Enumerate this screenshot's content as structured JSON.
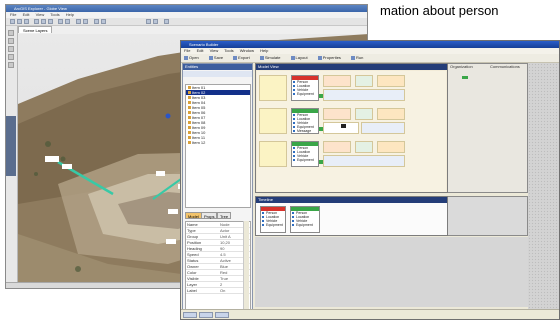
{
  "headline": {
    "text": "mation about person"
  },
  "back_window": {
    "title": "ArcGIS Explorer - Globe View",
    "menu": [
      "File",
      "Edit",
      "View",
      "Tools",
      "Help"
    ],
    "tab": "Scene Layers"
  },
  "front_window": {
    "title": "Scenario Builder",
    "menu": [
      "File",
      "Edit",
      "View",
      "Tools",
      "Window",
      "Help"
    ],
    "toolbar": [
      "Open",
      "Save",
      "Export",
      "Simulate",
      "Layout",
      "Properties",
      "Run"
    ],
    "panel_title": "Entities",
    "list_items": [
      "Item 01",
      "Item 02",
      "Item 03",
      "Item 04",
      "Item 05",
      "Item 06",
      "Item 07",
      "Item 08",
      "Item 09",
      "Item 10",
      "Item 11",
      "Item 12"
    ],
    "selected_index": 1,
    "tabs": [
      "Model",
      "Props",
      "Tree"
    ],
    "properties": [
      {
        "k": "Name",
        "v": "Node"
      },
      {
        "k": "Type",
        "v": "Actor"
      },
      {
        "k": "Group",
        "v": "Unit A"
      },
      {
        "k": "Position",
        "v": "10,20"
      },
      {
        "k": "Heading",
        "v": "90"
      },
      {
        "k": "Speed",
        "v": "4.5"
      },
      {
        "k": "Status",
        "v": "Active"
      },
      {
        "k": "Owner",
        "v": "Blue"
      },
      {
        "k": "Color",
        "v": "Red"
      },
      {
        "k": "Visible",
        "v": "True"
      },
      {
        "k": "Layer",
        "v": "2"
      },
      {
        "k": "Label",
        "v": "On"
      }
    ],
    "diagram_title": "Model View",
    "diagram_labels": {
      "a": "Organization",
      "b": "Communications"
    },
    "node_lines": [
      "Person",
      "Location",
      "Vehicle",
      "Equipment",
      "Message"
    ],
    "lower_title": "Timeline"
  }
}
